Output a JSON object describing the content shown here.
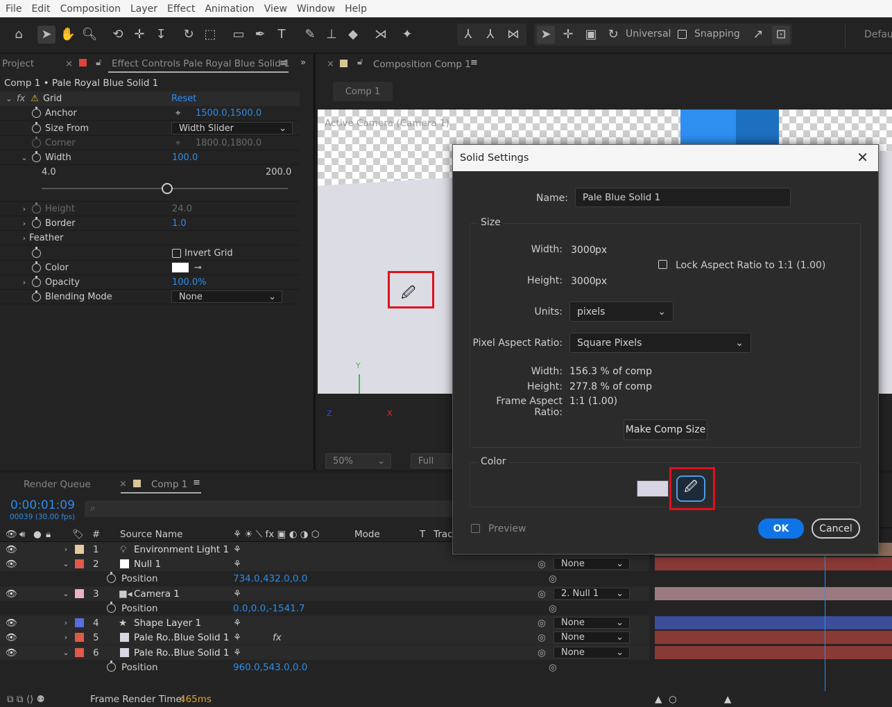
{
  "menu": [
    "File",
    "Edit",
    "Composition",
    "Layer",
    "Effect",
    "Animation",
    "View",
    "Window",
    "Help"
  ],
  "toolbar": {
    "universal": "Universal",
    "snapping": "Snapping",
    "workspace": "Defau"
  },
  "project_tab": "Project",
  "effect_controls": {
    "tab": "Effect Controls Pale Royal Blue Solid 1",
    "layer_path": "Comp 1 • Pale Royal Blue Solid 1",
    "effect_name": "Grid",
    "reset": "Reset",
    "rows": [
      {
        "label": "Anchor",
        "value": "1500.0,1500.0"
      },
      {
        "label": "Size From",
        "value": "Width Slider"
      },
      {
        "label": "Corner",
        "value": "1800.0,1800.0"
      },
      {
        "label": "Width",
        "value": "100.0"
      },
      {
        "label": "Height",
        "value": "24.0"
      },
      {
        "label": "Border",
        "value": "1.0"
      },
      {
        "label": "Feather",
        "value": ""
      },
      {
        "label": "",
        "value": "Invert Grid"
      },
      {
        "label": "Color",
        "value": ""
      },
      {
        "label": "Opacity",
        "value": "100.0%"
      },
      {
        "label": "Blending Mode",
        "value": "None"
      }
    ],
    "slider_min": "4.0",
    "slider_max": "200.0"
  },
  "composition": {
    "tab": "Composition Comp 1",
    "comp_button": "Comp 1",
    "camera_label": "Active Camera (Camera 1)",
    "zoom": "50%",
    "quality": "Full",
    "axis_y": "Y",
    "axis_x": "X",
    "axis_z": "Z"
  },
  "dialog": {
    "title": "Solid Settings",
    "name_label": "Name:",
    "name_value": "Pale Blue Solid 1",
    "size_group": "Size",
    "width_label": "Width:",
    "width_value": "3000",
    "px": "px",
    "height_label": "Height:",
    "height_value": "3000",
    "lock_label": "Lock Aspect Ratio to 1:1 (1.00)",
    "units_label": "Units:",
    "units_value": "pixels",
    "par_label": "Pixel Aspect Ratio:",
    "par_value": "Square Pixels",
    "w_pct_label": "Width:",
    "w_pct_value": "156.3 % of comp",
    "h_pct_label": "Height:",
    "h_pct_value": "277.8 % of comp",
    "far_label": "Frame Aspect Ratio:",
    "far_value": "1:1 (1.00)",
    "make_comp_size": "Make Comp Size",
    "color_group": "Color",
    "preview": "Preview",
    "ok": "OK",
    "cancel": "Cancel",
    "color_swatch": "#d8d6e4"
  },
  "timeline": {
    "render_queue": "Render Queue",
    "comp_tab": "Comp 1",
    "timecode": "0:00:01:09",
    "frames": "00039 (30.00 fps)",
    "col_hash": "#",
    "col_source": "Source Name",
    "col_mode": "Mode",
    "col_t": "T",
    "col_track": "Trac",
    "layers": [
      {
        "num": "1",
        "name": "Environment Light 1",
        "color": "#e8c9a0",
        "parent": ""
      },
      {
        "num": "2",
        "name": "Null 1",
        "color": "#e05a4a",
        "parent": "None"
      },
      {
        "prop": "Position",
        "value": "734.0,432.0,0.0"
      },
      {
        "num": "3",
        "name": "Camera 1",
        "color": "#e8b4c0",
        "parent": "2. Null 1"
      },
      {
        "prop": "Position",
        "value": "0.0,0.0,-1541.7"
      },
      {
        "num": "4",
        "name": "Shape Layer 1",
        "color": "#5a6ee0",
        "parent": "None"
      },
      {
        "num": "5",
        "name": "Pale Ro..Blue Solid 1",
        "color": "#e05a4a",
        "parent": "None"
      },
      {
        "num": "6",
        "name": "Pale Ro..Blue Solid 1",
        "color": "#e05a4a",
        "parent": "None"
      },
      {
        "prop": "Position",
        "value": "960.0,543.0,0.0"
      }
    ],
    "frame_render_label": "Frame Render Time:",
    "frame_render_value": "465ms"
  }
}
